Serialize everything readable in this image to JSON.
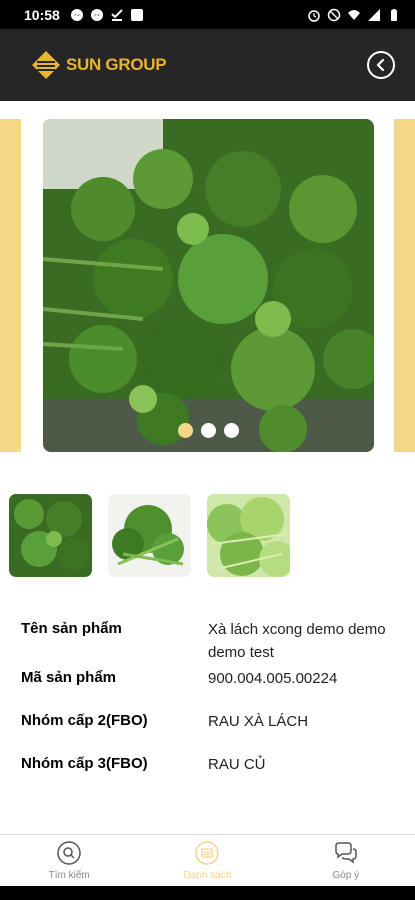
{
  "status": {
    "time": "10:58"
  },
  "header": {
    "logo_text": "SUN GROUP"
  },
  "carousel": {
    "dots": 3,
    "active": 0
  },
  "product": {
    "rows": [
      {
        "label": "Tên sản phẩm",
        "value": "Xà lách xcong demo demo demo test"
      },
      {
        "label": "Mã sản phẩm",
        "value": "900.004.005.00224"
      },
      {
        "label": "Nhóm cấp 2(FBO)",
        "value": "RAU XÀ LÁCH"
      },
      {
        "label": "Nhóm cấp 3(FBO)",
        "value": "RAU CỦ"
      }
    ]
  },
  "nav": {
    "search": "Tìm kiếm",
    "list": "Danh sách",
    "feedback": "Góp ý"
  },
  "colors": {
    "accent": "#f5d78a",
    "header_bg": "#262626",
    "logo": "#e9b530"
  }
}
